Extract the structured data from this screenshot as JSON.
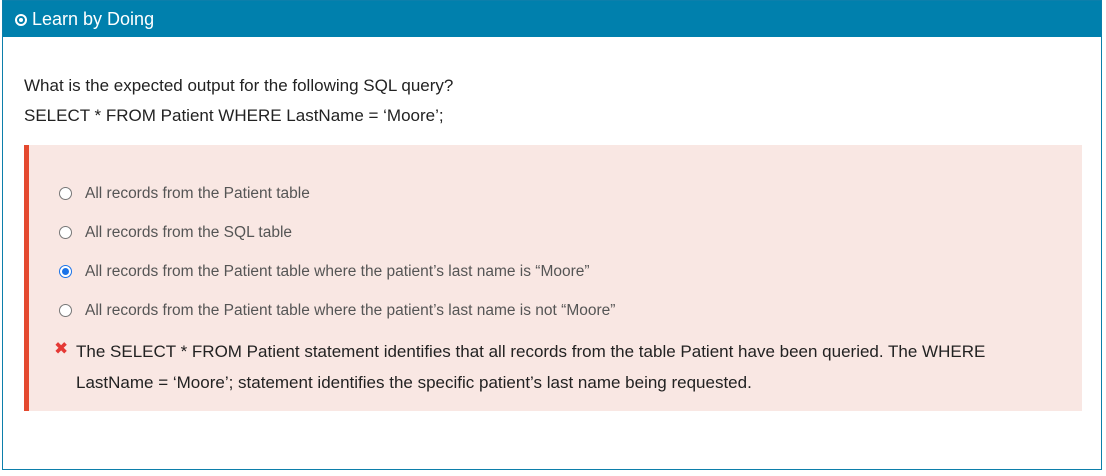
{
  "header": {
    "title": "Learn by Doing",
    "icon": "target-icon"
  },
  "question": {
    "line1": "What is the expected output for the following SQL query?",
    "line2": "SELECT * FROM Patient WHERE LastName = ‘Moore’;"
  },
  "options": [
    {
      "label": "All records from the Patient table",
      "selected": false
    },
    {
      "label": "All records from the SQL table",
      "selected": false
    },
    {
      "label": "All records from the Patient table where the patient’s last name is “Moore”",
      "selected": true
    },
    {
      "label": "All records from the Patient table where the patient’s last name is not “Moore”",
      "selected": false
    }
  ],
  "feedback": {
    "icon": "x-mark-icon",
    "text": "The SELECT * FROM Patient statement identifies that all records from the table Patient have been queried. The WHERE LastName = ‘Moore’; statement identifies the specific patient’s last name being requested."
  },
  "colors": {
    "header_bg": "#0080ad",
    "answer_bg": "#f9e7e3",
    "answer_border": "#e4492f",
    "error_icon": "#e53935",
    "radio_selected": "#1a73e8"
  }
}
